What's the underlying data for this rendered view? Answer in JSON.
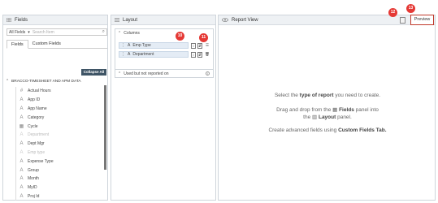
{
  "fields_panel": {
    "title": "Fields",
    "filter_label": "All Fields",
    "search_placeholder": "Search Item",
    "tabs": [
      "Fields",
      "Custom Fields"
    ],
    "collapse_label": "Collapse All",
    "group_title": "BRACCO-TIMESHEET AND APM DATA",
    "items": [
      {
        "icon": "hash-icon",
        "label": "Actual Hours",
        "faded": false
      },
      {
        "icon": "text-a-icon",
        "label": "App ID",
        "faded": false
      },
      {
        "icon": "text-a-icon",
        "label": "App Name",
        "faded": false
      },
      {
        "icon": "text-a-icon",
        "label": "Category",
        "faded": false
      },
      {
        "icon": "calendar-icon",
        "label": "Cycle",
        "faded": false
      },
      {
        "icon": "text-a-icon",
        "label": "Department",
        "faded": true
      },
      {
        "icon": "text-a-icon",
        "label": "Dept Mgr",
        "faded": false
      },
      {
        "icon": "text-a-icon",
        "label": "Emp type",
        "faded": true
      },
      {
        "icon": "text-a-icon",
        "label": "Expense Type",
        "faded": false
      },
      {
        "icon": "text-a-icon",
        "label": "Group",
        "faded": false
      },
      {
        "icon": "text-a-icon",
        "label": "Month",
        "faded": false
      },
      {
        "icon": "text-a-icon",
        "label": "MyID",
        "faded": false
      },
      {
        "icon": "text-a-icon",
        "label": "Proj Id",
        "faded": false
      }
    ]
  },
  "layout_panel": {
    "title": "Layout",
    "columns_label": "Columns",
    "columns": [
      "Emp Type",
      "Department"
    ],
    "unused_label": "Used but not reported on"
  },
  "report_panel": {
    "title": "Report View",
    "line1_pre": "Select the ",
    "line1_bold": "type of report",
    "line1_post": " you need to create.",
    "line2_pre": "Drag and drop from the ",
    "line2_bold1": "Fields",
    "line2_mid": " panel into",
    "line3_pre": "the ",
    "line3_bold": "Layout",
    "line3_post": " panel.",
    "line4_pre": "Create advanced fields using ",
    "line4_bold": "Custom Fields Tab."
  },
  "toolbar": {
    "preview_label": "Preview"
  },
  "badges": [
    "10",
    "11",
    "12",
    "13"
  ],
  "colors": {
    "badge": "#e53935",
    "collapse_button": "#3f5566",
    "column_item": "#e4ecf5",
    "preview_border": "#c0392b"
  }
}
